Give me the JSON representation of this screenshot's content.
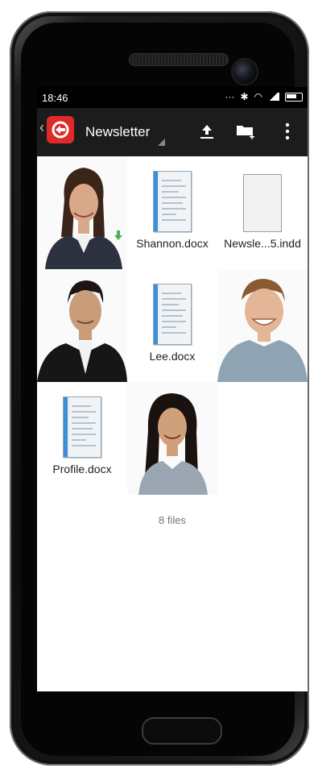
{
  "status_bar": {
    "time": "18:46",
    "icons": [
      "more-dots-icon",
      "bluetooth-icon",
      "wifi-icon",
      "signal-icon",
      "battery-icon"
    ]
  },
  "app_bar": {
    "title": "Newsletter",
    "actions": [
      "upload-icon",
      "new-folder-icon",
      "overflow-menu-icon"
    ],
    "colors": {
      "bar": "#1c1c1c",
      "logo": "#e02a2a"
    }
  },
  "files": [
    {
      "type": "photo",
      "label": "",
      "icon": "woman-brown-hair-photo"
    },
    {
      "type": "docx",
      "label": "Shannon.docx"
    },
    {
      "type": "indd",
      "label": "Newsle...5.indd"
    },
    {
      "type": "photo",
      "label": "",
      "icon": "man-suit-photo"
    },
    {
      "type": "docx",
      "label": "Lee.docx"
    },
    {
      "type": "photo",
      "label": "",
      "icon": "man-blonde-photo"
    },
    {
      "type": "docx",
      "label": "Profile.docx"
    },
    {
      "type": "photo",
      "label": "",
      "icon": "woman-long-dark-hair-photo"
    }
  ],
  "footer": {
    "count": "8 files"
  }
}
